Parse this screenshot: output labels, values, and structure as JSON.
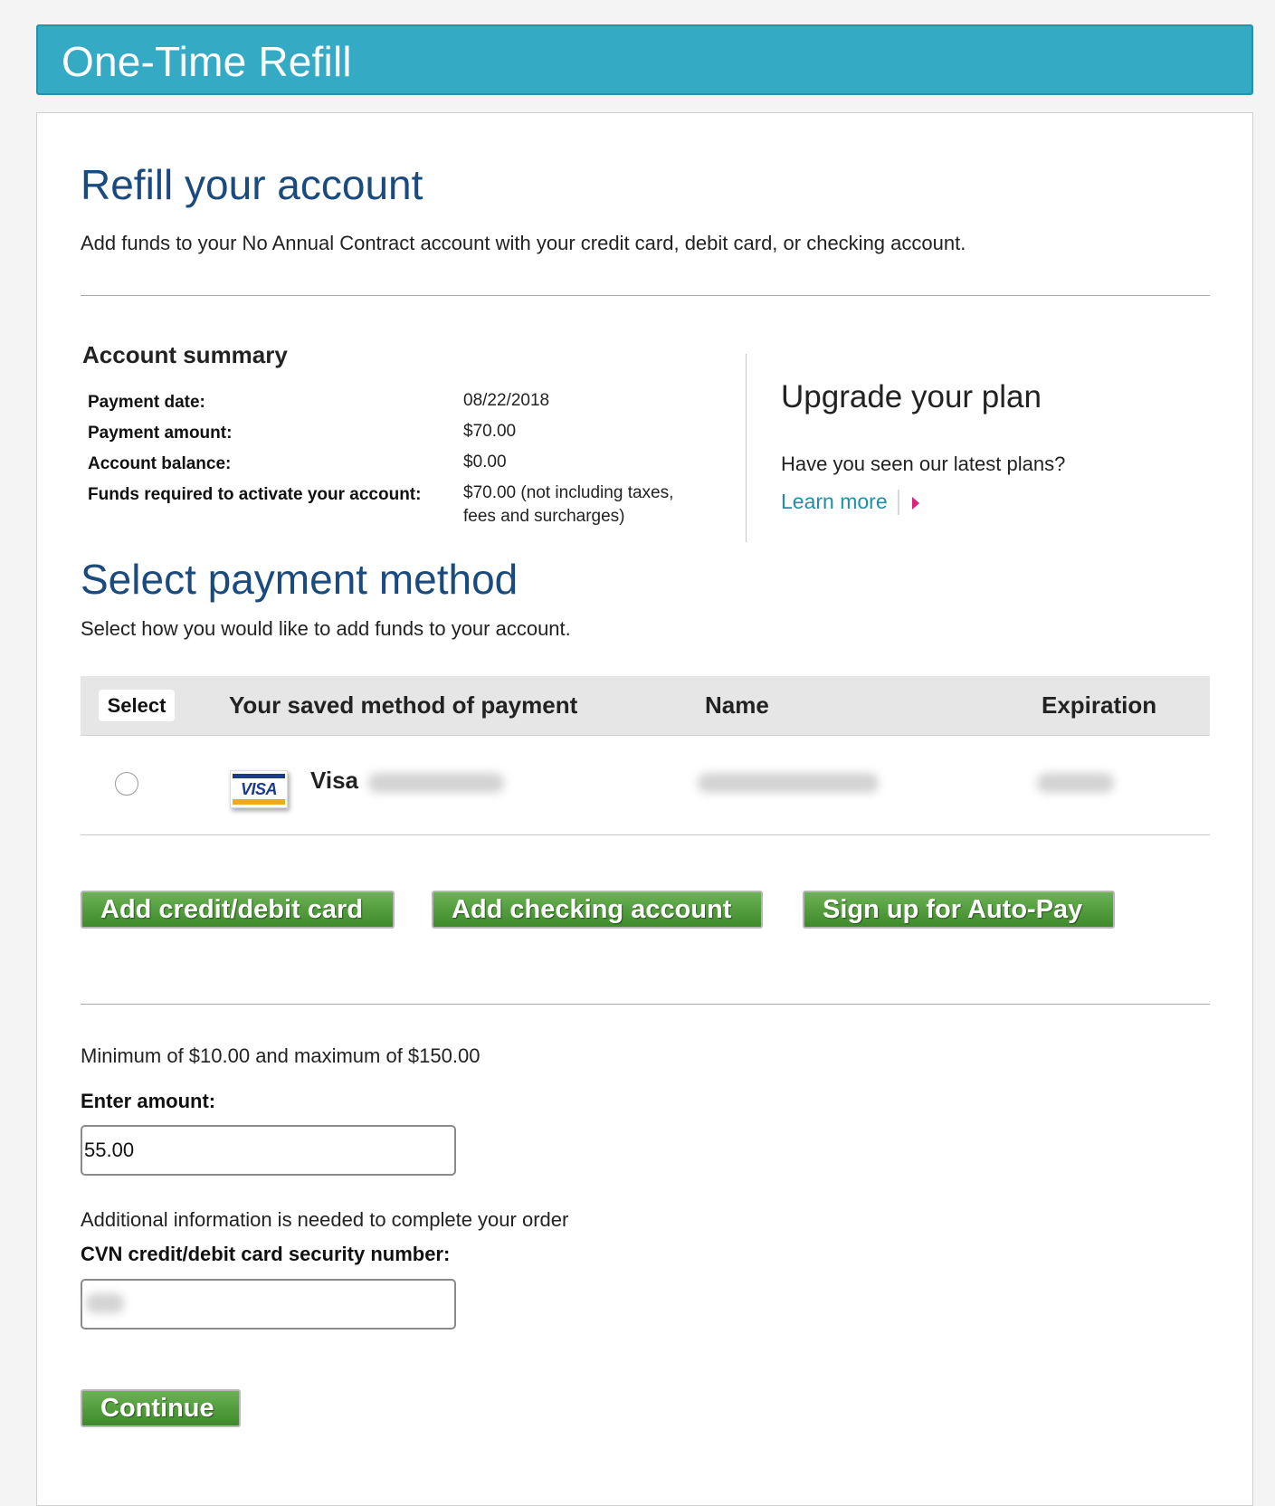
{
  "header": {
    "title": "One-Time Refill"
  },
  "refill": {
    "heading": "Refill your account",
    "intro": "Add funds to your No Annual Contract account with your credit card, debit card, or checking account."
  },
  "summary": {
    "title": "Account summary",
    "rows": [
      {
        "label": "Payment date:",
        "value": "08/22/2018"
      },
      {
        "label": "Payment amount:",
        "value": "$70.00"
      },
      {
        "label": "Account balance:",
        "value": "$0.00"
      },
      {
        "label": "Funds required to activate your account:",
        "value_line1": "$70.00 (not including taxes,",
        "value_line2": "fees and surcharges)"
      }
    ]
  },
  "upgrade": {
    "title": "Upgrade your plan",
    "text": "Have you seen our latest plans?",
    "link": "Learn more"
  },
  "payment": {
    "heading": "Select payment method",
    "intro": "Select how you would like to add funds to your account.",
    "columns": {
      "select": "Select",
      "method": "Your saved method of payment",
      "name": "Name",
      "expiration": "Expiration"
    },
    "rows": [
      {
        "card_type": "Visa",
        "card_icon": "visa-card-icon",
        "selected": false
      }
    ],
    "buttons": {
      "add_card": "Add credit/debit card",
      "add_checking": "Add checking account",
      "autopay": "Sign up for Auto-Pay"
    }
  },
  "amount": {
    "limits": "Minimum of $10.00 and maximum of $150.00",
    "label": "Enter amount:",
    "value": "55.00",
    "additional_info": "Additional information is needed to complete your order",
    "cvn_label": "CVN credit/debit card security number:"
  },
  "actions": {
    "continue": "Continue"
  },
  "colors": {
    "header_bg": "#35aac5",
    "heading_blue": "#1b4b7e",
    "link_teal": "#1f8fa6",
    "arrow_pink": "#e0207a",
    "button_green": "#4f9a38"
  }
}
